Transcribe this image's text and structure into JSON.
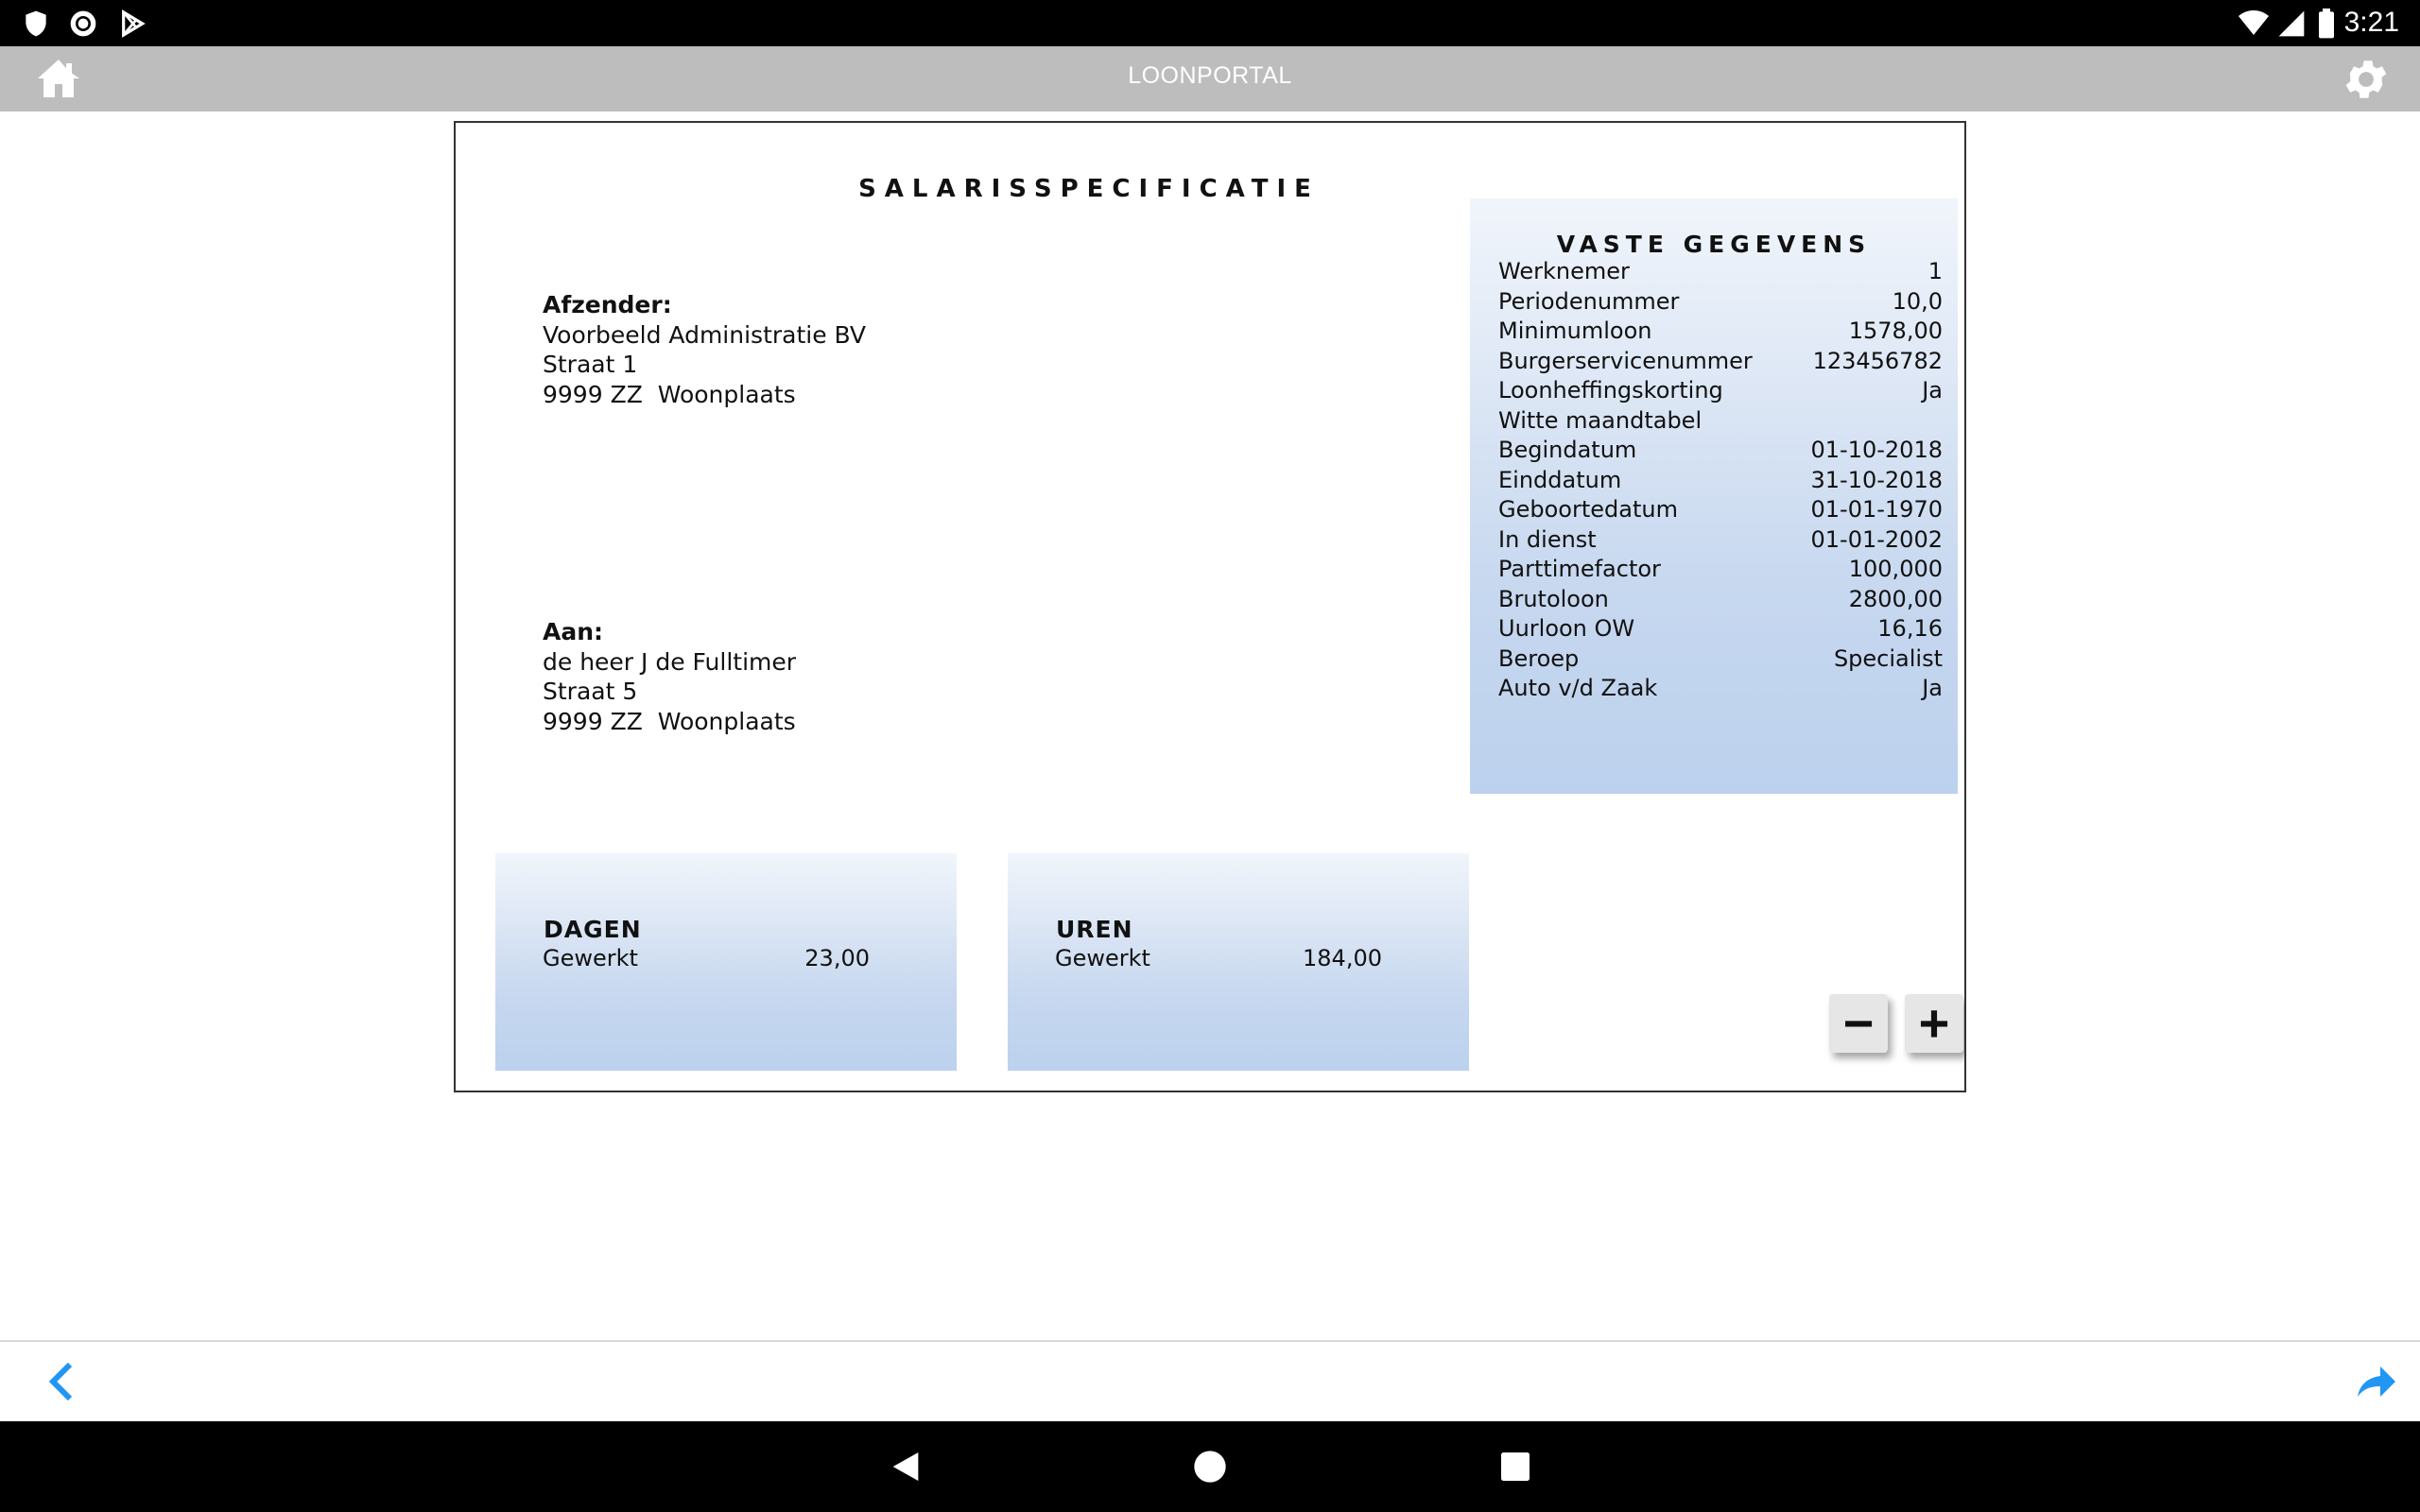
{
  "status_bar": {
    "time": "3:21",
    "left_icons": [
      "shield-icon",
      "circle-record-icon",
      "play-store-icon"
    ],
    "right_icons": [
      "wifi-icon",
      "cellular-signal-icon",
      "battery-icon"
    ]
  },
  "app_bar": {
    "title": "LOONPORTAL",
    "home_icon": "home-icon",
    "settings_icon": "gear-icon"
  },
  "document": {
    "title": "SALARISSPECIFICATIE",
    "sender": {
      "label": "Afzender:",
      "lines": [
        "Voorbeeld Administratie BV",
        "Straat 1",
        "9999 ZZ  Woonplaats"
      ]
    },
    "recipient": {
      "label": "Aan:",
      "lines": [
        "de heer J de Fulltimer",
        "Straat 5",
        "9999 ZZ  Woonplaats"
      ]
    },
    "vaste_gegevens": {
      "title": "VASTE GEGEVENS",
      "rows": [
        {
          "label": "Werknemer",
          "value": "1"
        },
        {
          "label": "Periodenummer",
          "value": "10,0"
        },
        {
          "label": "Minimumloon",
          "value": "1578,00"
        },
        {
          "label": "Burgerservicenummer",
          "value": "123456782"
        },
        {
          "label": "Loonheffingskorting",
          "value": "Ja"
        },
        {
          "label": "Witte maandtabel",
          "value": ""
        },
        {
          "label": "Begindatum",
          "value": "01-10-2018"
        },
        {
          "label": "Einddatum",
          "value": "31-10-2018"
        },
        {
          "label": "Geboortedatum",
          "value": "01-01-1970"
        },
        {
          "label": "In dienst",
          "value": "01-01-2002"
        },
        {
          "label": "Parttimefactor",
          "value": "100,000"
        },
        {
          "label": "Brutoloon",
          "value": "2800,00"
        },
        {
          "label": "Uurloon OW",
          "value": "16,16"
        },
        {
          "label": "Beroep",
          "value": "Specialist"
        },
        {
          "label": "Auto v/d Zaak",
          "value": "Ja"
        }
      ]
    },
    "dagen": {
      "title": "DAGEN",
      "label": "Gewerkt",
      "value": "23,00"
    },
    "uren": {
      "title": "UREN",
      "label": "Gewerkt",
      "value": "184,00"
    },
    "zoom": {
      "out_label": "−",
      "in_label": "+"
    }
  },
  "bottom_bar": {
    "back_icon": "chevron-left-icon",
    "forward_icon": "share-forward-icon",
    "accent_color": "#2196f3"
  },
  "nav_bar": {
    "icons": [
      "nav-back-icon",
      "nav-home-icon",
      "nav-recents-icon"
    ]
  }
}
